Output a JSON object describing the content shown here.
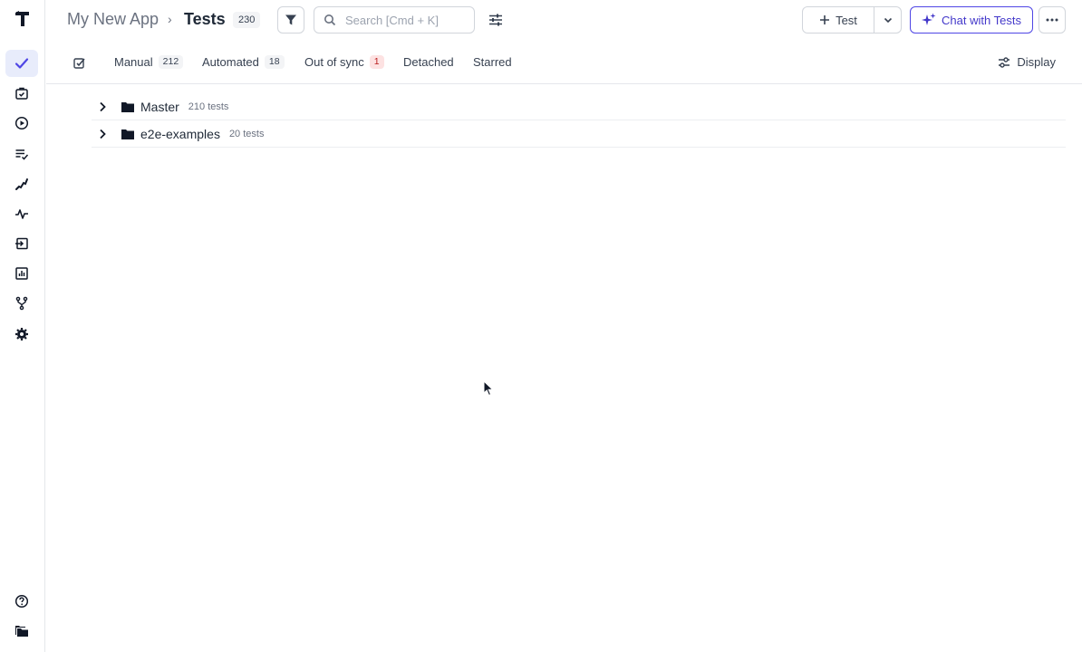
{
  "header": {
    "app_name": "My New App",
    "page_title": "Tests",
    "test_count": "230",
    "search_placeholder": "Search [Cmd + K]",
    "new_test_label": "Test",
    "chat_label": "Chat with Tests"
  },
  "sidebar": {
    "items": [
      {
        "icon": "check-icon",
        "active": true
      },
      {
        "icon": "suitcase-check-icon"
      },
      {
        "icon": "play-circle-icon"
      },
      {
        "icon": "list-check-icon"
      },
      {
        "icon": "steps-icon"
      },
      {
        "icon": "pulse-icon"
      },
      {
        "icon": "import-icon"
      },
      {
        "icon": "analytics-icon"
      },
      {
        "icon": "branch-icon"
      },
      {
        "icon": "gear-icon"
      }
    ],
    "bottom": [
      {
        "icon": "help-icon"
      },
      {
        "icon": "folders-icon"
      }
    ]
  },
  "tabs": [
    {
      "label": "Manual",
      "count": "212"
    },
    {
      "label": "Automated",
      "count": "18"
    },
    {
      "label": "Out of sync",
      "count": "1"
    },
    {
      "label": "Detached"
    },
    {
      "label": "Starred"
    }
  ],
  "display_label": "Display",
  "folders": [
    {
      "name": "Master",
      "count": "210 tests"
    },
    {
      "name": "e2e-examples",
      "count": "20 tests"
    }
  ],
  "colors": {
    "accent": "#4f46e5",
    "active_bg": "#e8ecfb",
    "alert_badge_bg": "#fde2e2"
  }
}
